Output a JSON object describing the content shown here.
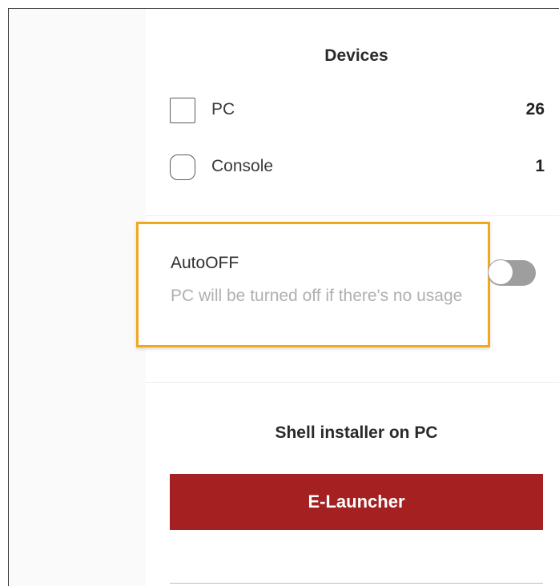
{
  "devices": {
    "title": "Devices",
    "items": [
      {
        "label": "PC",
        "count": "26",
        "checked": false
      },
      {
        "label": "Console",
        "count": "1",
        "checked": false
      }
    ]
  },
  "autooff": {
    "title": "AutoOFF",
    "description": "PC will be turned off if there's no usage",
    "enabled": false,
    "highlight_color": "#f2a81d"
  },
  "installer": {
    "title": "Shell installer on PC",
    "button_label": "E-Launcher",
    "button_color": "#a42021"
  }
}
